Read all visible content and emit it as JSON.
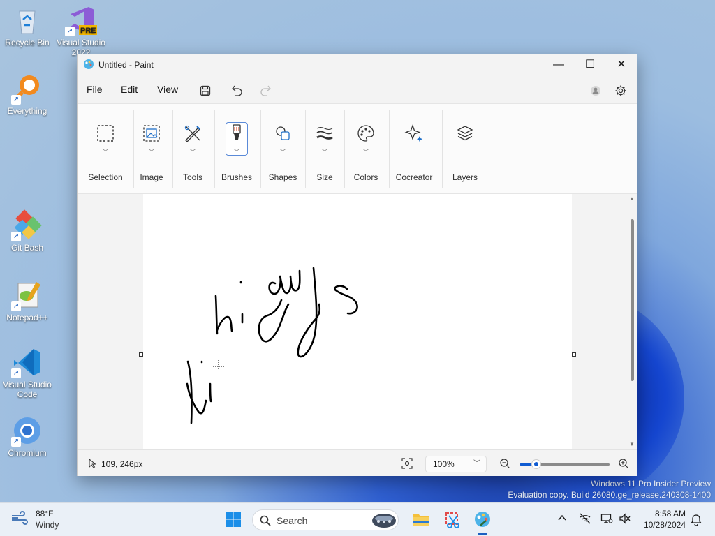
{
  "desktop": {
    "icons": [
      {
        "label": "Recycle Bin",
        "icon": "recycle-bin-icon"
      },
      {
        "label": "Visual Studio 2022",
        "icon": "visual-studio-icon",
        "badge": "PRE"
      },
      {
        "label": "Everything",
        "icon": "everything-search-icon"
      },
      {
        "label": "Git Bash",
        "icon": "git-bash-icon"
      },
      {
        "label": "Notepad++",
        "icon": "notepad-plus-plus-icon"
      },
      {
        "label": "Visual Studio Code",
        "icon": "vscode-icon"
      },
      {
        "label": "Chromium",
        "icon": "chromium-icon"
      }
    ],
    "watermark_line1": "Windows 11 Pro Insider Preview",
    "watermark_line2": "Evaluation copy. Build 26080.ge_release.240308-1400"
  },
  "window": {
    "title": "Untitled - Paint",
    "controls": {
      "minimize": "—",
      "maximize": "☐",
      "close": "✕"
    },
    "menu": [
      "File",
      "Edit",
      "View"
    ],
    "ribbon": [
      {
        "label": "Selection",
        "icon": "selection-icon"
      },
      {
        "label": "Image",
        "icon": "image-icon"
      },
      {
        "label": "Tools",
        "icon": "tools-icon"
      },
      {
        "label": "Brushes",
        "icon": "brush-icon",
        "active": true
      },
      {
        "label": "Shapes",
        "icon": "shapes-icon"
      },
      {
        "label": "Size",
        "icon": "size-icon"
      },
      {
        "label": "Colors",
        "icon": "palette-icon"
      },
      {
        "label": "Cocreator",
        "icon": "sparkle-icon"
      },
      {
        "label": "Layers",
        "icon": "layers-icon"
      }
    ],
    "status": {
      "cursor_position": "109, 246px",
      "zoom": "100%",
      "zoom_level": 0.18
    },
    "accent_color": "#0f5bd2"
  },
  "taskbar": {
    "weather_temp": "88°F",
    "weather_condition": "Windy",
    "search_placeholder": "Search",
    "time": "8:58 AM",
    "date": "10/28/2024"
  }
}
